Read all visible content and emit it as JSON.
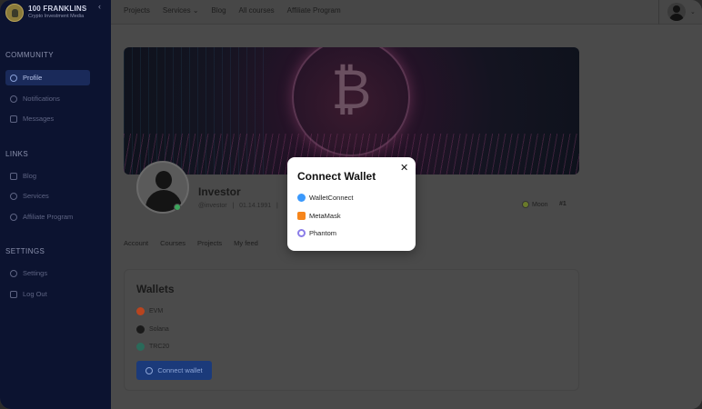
{
  "brand": {
    "name": "100 FRANKLINS",
    "subtitle": "Crypto Investment Media"
  },
  "sidebar": {
    "sections": [
      {
        "title": "COMMUNITY",
        "items": [
          {
            "label": "Profile",
            "icon": "user-icon",
            "active": true
          },
          {
            "label": "Notifications",
            "icon": "bell-icon"
          },
          {
            "label": "Messages",
            "icon": "mail-icon"
          }
        ]
      },
      {
        "title": "LINKS",
        "items": [
          {
            "label": "Blog",
            "icon": "document-icon"
          },
          {
            "label": "Services",
            "icon": "gear-icon"
          },
          {
            "label": "Affiliate Program",
            "icon": "star-icon"
          }
        ]
      },
      {
        "title": "SETTINGS",
        "items": [
          {
            "label": "Settings",
            "icon": "gear-icon"
          },
          {
            "label": "Log Out",
            "icon": "logout-icon"
          }
        ]
      }
    ]
  },
  "topnav": {
    "items": [
      "Projects",
      "Services",
      "Blog",
      "All courses",
      "Affiliate Program"
    ]
  },
  "profile": {
    "name": "Investor",
    "handle": "@investor",
    "date": "01.14.1991",
    "badge": "Moon",
    "rank": "#1"
  },
  "tabs": [
    "Account",
    "Courses",
    "Projects",
    "My feed"
  ],
  "wallets": {
    "title": "Wallets",
    "items": [
      {
        "label": "EVM",
        "color": "#b8441f"
      },
      {
        "label": "Solana",
        "color": "#1a1a1a"
      },
      {
        "label": "TRC20",
        "color": "#2a6a5a"
      }
    ],
    "connect_label": "Connect wallet"
  },
  "modal": {
    "title": "Connect Wallet",
    "close": "✕",
    "options": [
      {
        "label": "WalletConnect",
        "icon": "walletconnect-icon"
      },
      {
        "label": "MetaMask",
        "icon": "metamask-icon"
      },
      {
        "label": "Phantom",
        "icon": "phantom-icon"
      }
    ]
  }
}
